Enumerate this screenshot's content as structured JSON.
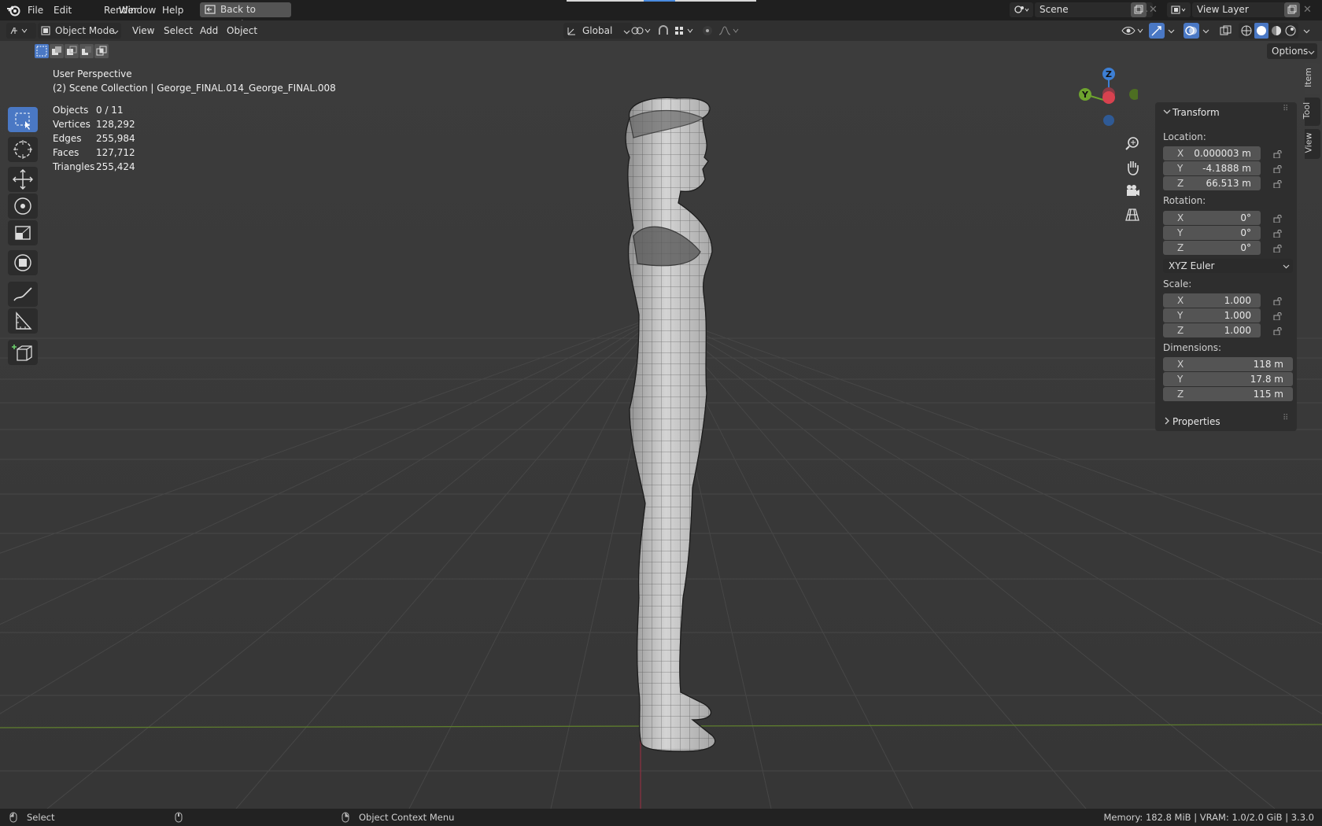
{
  "menus": {
    "file": "File",
    "edit": "Edit",
    "render": "Render",
    "window": "Window",
    "help": "Help"
  },
  "back_button": "Back to Previous",
  "scene": {
    "name": "Scene",
    "view_layer": "View Layer"
  },
  "header": {
    "mode": "Object Mode",
    "view": "View",
    "select": "Select",
    "add": "Add",
    "object": "Object",
    "orientation": "Global",
    "options": "Options"
  },
  "overlay": {
    "perspective": "User Perspective",
    "collection": "(2) Scene Collection | George_FINAL.014_George_FINAL.008",
    "stats": [
      {
        "label": "Objects",
        "value": "0 / 11"
      },
      {
        "label": "Vertices",
        "value": "128,292"
      },
      {
        "label": "Edges",
        "value": "255,984"
      },
      {
        "label": "Faces",
        "value": "127,712"
      },
      {
        "label": "Triangles",
        "value": "255,424"
      }
    ]
  },
  "gizmo": {
    "z": "Z",
    "y": "Y"
  },
  "npanel": {
    "transform": "Transform",
    "location_label": "Location:",
    "location": [
      {
        "axis": "X",
        "value": "0.000003 m"
      },
      {
        "axis": "Y",
        "value": "-4.1888 m"
      },
      {
        "axis": "Z",
        "value": "66.513 m"
      }
    ],
    "rotation_label": "Rotation:",
    "rotation": [
      {
        "axis": "X",
        "value": "0°"
      },
      {
        "axis": "Y",
        "value": "0°"
      },
      {
        "axis": "Z",
        "value": "0°"
      }
    ],
    "rotation_mode": "XYZ Euler",
    "scale_label": "Scale:",
    "scale": [
      {
        "axis": "X",
        "value": "1.000"
      },
      {
        "axis": "Y",
        "value": "1.000"
      },
      {
        "axis": "Z",
        "value": "1.000"
      }
    ],
    "dimensions_label": "Dimensions:",
    "dimensions": [
      {
        "axis": "X",
        "value": "118 m"
      },
      {
        "axis": "Y",
        "value": "17.8 m"
      },
      {
        "axis": "Z",
        "value": "115 m"
      }
    ],
    "properties": "Properties",
    "tabs": {
      "item": "Item",
      "tool": "Tool",
      "view": "View"
    }
  },
  "status": {
    "select": "Select",
    "context_menu": "Object Context Menu",
    "info": "Memory: 182.8 MiB | VRAM: 1.0/2.0 GiB | 3.3.0"
  },
  "colors": {
    "active_tool": "#4a78c4",
    "x_axis": "#d8424f",
    "y_axis": "#6ea42e",
    "z_axis": "#3d7fd4"
  }
}
